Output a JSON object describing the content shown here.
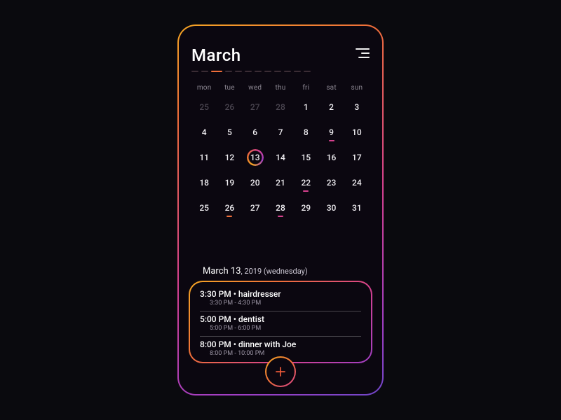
{
  "header": {
    "month": "March"
  },
  "pager": {
    "count": 12,
    "active": 2
  },
  "weekdays": [
    "mon",
    "tue",
    "wed",
    "thu",
    "fri",
    "sat",
    "sun"
  ],
  "days": [
    {
      "n": "25",
      "prev": true
    },
    {
      "n": "26",
      "prev": true
    },
    {
      "n": "27",
      "prev": true
    },
    {
      "n": "28",
      "prev": true
    },
    {
      "n": "1"
    },
    {
      "n": "2"
    },
    {
      "n": "3"
    },
    {
      "n": "4"
    },
    {
      "n": "5"
    },
    {
      "n": "6"
    },
    {
      "n": "7"
    },
    {
      "n": "8"
    },
    {
      "n": "9",
      "dot": "c2"
    },
    {
      "n": "10"
    },
    {
      "n": "11"
    },
    {
      "n": "12"
    },
    {
      "n": "13",
      "selected": true
    },
    {
      "n": "14"
    },
    {
      "n": "15"
    },
    {
      "n": "16"
    },
    {
      "n": "17"
    },
    {
      "n": "18"
    },
    {
      "n": "19"
    },
    {
      "n": "20"
    },
    {
      "n": "21"
    },
    {
      "n": "22",
      "dot": "c2"
    },
    {
      "n": "23"
    },
    {
      "n": "24"
    },
    {
      "n": "25"
    },
    {
      "n": "26",
      "dot": "c1"
    },
    {
      "n": "27"
    },
    {
      "n": "28",
      "dot": "c2"
    },
    {
      "n": "29"
    },
    {
      "n": "30"
    },
    {
      "n": "31"
    }
  ],
  "selected_label": {
    "prefix": "March 13",
    "suffix": ", 2019 (wednesday)"
  },
  "events": [
    {
      "main": "3:30 PM • hairdresser",
      "sub": "3:30 PM - 4:30 PM"
    },
    {
      "main": "5:00 PM • dentist",
      "sub": "5:00 PM - 6:00 PM"
    },
    {
      "main": "8:00 PM • dinner with Joe",
      "sub": "8:00 PM - 10:00 PM"
    }
  ]
}
